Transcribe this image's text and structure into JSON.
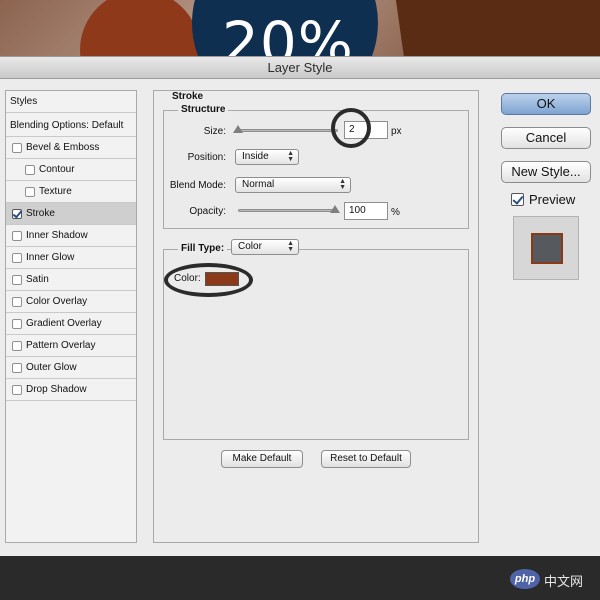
{
  "background": {
    "percent_text": "20%",
    "colors": {
      "orange_circle": "#8e3a1a",
      "navy_circle": "#0f2f50",
      "brown_band": "#5a2c14"
    }
  },
  "window": {
    "title": "Layer Style"
  },
  "styles_list": {
    "header": "Styles",
    "blending": "Blending Options: Default",
    "items": [
      {
        "label": "Bevel & Emboss",
        "checked": false
      },
      {
        "label": "Contour",
        "checked": false
      },
      {
        "label": "Texture",
        "checked": false
      },
      {
        "label": "Stroke",
        "checked": true
      },
      {
        "label": "Inner Shadow",
        "checked": false
      },
      {
        "label": "Inner Glow",
        "checked": false
      },
      {
        "label": "Satin",
        "checked": false
      },
      {
        "label": "Color Overlay",
        "checked": false
      },
      {
        "label": "Gradient Overlay",
        "checked": false
      },
      {
        "label": "Pattern Overlay",
        "checked": false
      },
      {
        "label": "Outer Glow",
        "checked": false
      },
      {
        "label": "Drop Shadow",
        "checked": false
      }
    ]
  },
  "stroke": {
    "title": "Stroke",
    "structure": {
      "title": "Structure",
      "size": {
        "label": "Size:",
        "value": "2",
        "unit": "px"
      },
      "position": {
        "label": "Position:",
        "value": "Inside"
      },
      "blend_mode": {
        "label": "Blend Mode:",
        "value": "Normal"
      },
      "opacity": {
        "label": "Opacity:",
        "value": "100",
        "unit": "%"
      }
    },
    "fill": {
      "label": "Fill Type:",
      "value": "Color",
      "color_label": "Color:",
      "color_value": "#8c3919"
    },
    "make_default": "Make Default",
    "reset_default": "Reset to Default"
  },
  "buttons": {
    "ok": "OK",
    "cancel": "Cancel",
    "new_style": "New Style...",
    "preview": "Preview"
  },
  "preview": {
    "swatch_fill": "#565a5e",
    "stroke_color": "#8c3919"
  },
  "watermark": {
    "logo": "php",
    "text": "中文网"
  }
}
